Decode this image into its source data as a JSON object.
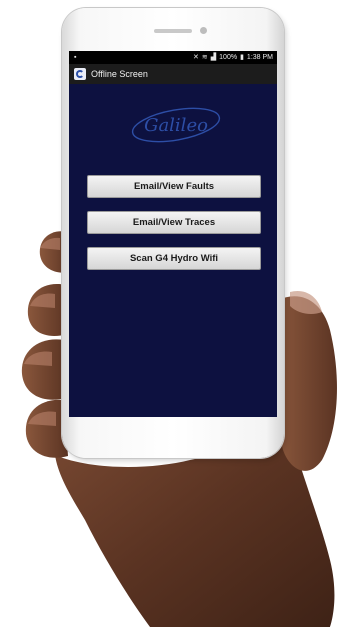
{
  "status_bar": {
    "left_icon": "image-notification-icon",
    "icons": [
      "mute-icon",
      "wifi-icon",
      "signal-icon"
    ],
    "battery": "100%",
    "time": "1:38 PM"
  },
  "app_bar": {
    "title": "Offline Screen",
    "icon": "app-logo-icon"
  },
  "logo": {
    "text": "Galileo",
    "color": "#2d4ea6"
  },
  "buttons": {
    "faults": "Email/View Faults",
    "traces": "Email/View Traces",
    "scan": "Scan G4 Hydro Wifi"
  },
  "colors": {
    "screen_background": "#0d1140",
    "status_bar": "#000000",
    "app_bar": "#1c1c1c",
    "button": "#e3e3e3"
  }
}
